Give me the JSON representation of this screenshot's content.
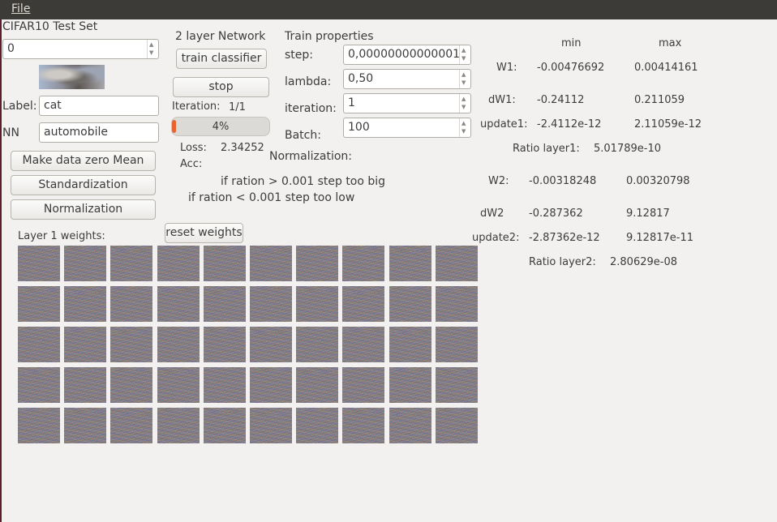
{
  "menubar": {
    "file": "File"
  },
  "dataset": {
    "title": "CIFAR10 Test Set",
    "index_value": "0",
    "label_caption": "Label:",
    "label_value": "cat",
    "nn_caption": "NN",
    "nn_value": "automobile"
  },
  "preprocess": {
    "zero_mean": "Make  data zero Mean",
    "standardization": "Standardization",
    "normalization": "Normalization"
  },
  "network": {
    "title": "2 layer Network",
    "train_button": "train classifier",
    "stop_button": "stop",
    "iteration_caption": "Iteration:",
    "iteration_value": "1/1",
    "progress_percent": 4,
    "progress_text": "4%",
    "loss_caption": "Loss:",
    "loss_value": "2.34252",
    "acc_caption": "Acc:",
    "normalization_caption": "Normalization:",
    "hint_big": "if ration > 0.001  step too big",
    "hint_low": "if ration < 0.001  step too low"
  },
  "train_props": {
    "title": "Train properties",
    "step_caption": "step:",
    "step_value": "0,00000000000001",
    "lambda_caption": "lambda:",
    "lambda_value": "0,50",
    "iteration_caption": "iteration:",
    "iteration_value": "1",
    "batch_caption": "Batch:",
    "batch_value": "100"
  },
  "weights": {
    "caption": "Layer 1 weights:",
    "reset_button": "reset weights",
    "rows": 5,
    "cols": 10
  },
  "stats": {
    "min_header": "min",
    "max_header": "max",
    "w1_caption": "W1:",
    "w1_min": "-0.00476692",
    "w1_max": "0.00414161",
    "dw1_caption": "dW1:",
    "dw1_min": "-0.24112",
    "dw1_max": "0.211059",
    "update1_caption": "update1:",
    "update1_min": "-2.4112e-12",
    "update1_max": "2.11059e-12",
    "ratio1_caption": "Ratio layer1:",
    "ratio1_value": "5.01789e-10",
    "w2_caption": "W2:",
    "w2_min": "-0.00318248",
    "w2_max": "0.00320798",
    "dw2_caption": "dW2",
    "dw2_min": "-0.287362",
    "dw2_max": "9.12817",
    "update2_caption": "update2:",
    "update2_min": "-2.87362e-12",
    "update2_max": "9.12817e-11",
    "ratio2_caption": "Ratio layer2:",
    "ratio2_value": "2.80629e-08"
  },
  "colors": {
    "menubar": "#3c3b37",
    "window": "#f2f1f0",
    "progress": "#e9622f"
  }
}
